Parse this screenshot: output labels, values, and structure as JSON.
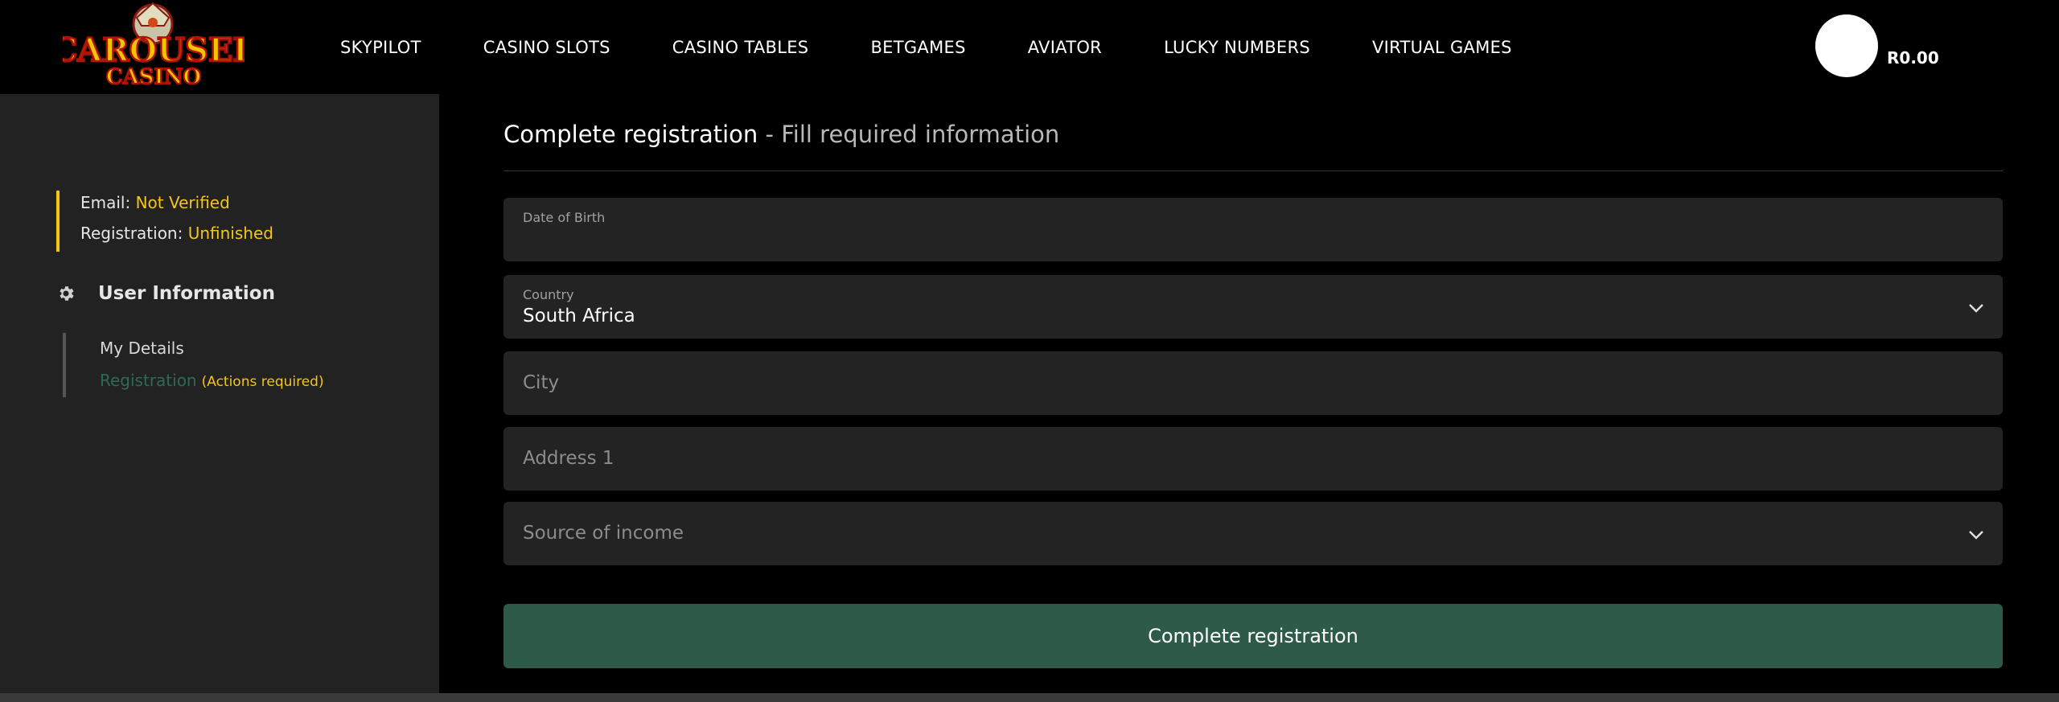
{
  "header": {
    "logo": {
      "line1": "CAROUSEL",
      "line2": "CASINO"
    },
    "nav": [
      "SKYPILOT",
      "CASINO SLOTS",
      "CASINO TABLES",
      "BETGAMES",
      "AVIATOR",
      "LUCKY NUMBERS",
      "VIRTUAL GAMES"
    ],
    "balance": "R0.00"
  },
  "sidebar": {
    "email_label": "Email: ",
    "email_status": "Not Verified",
    "registration_label": "Registration: ",
    "registration_status": "Unfinished",
    "section_title": "User Information",
    "items": {
      "details": "My Details",
      "registration": "Registration",
      "registration_note": "(Actions required)"
    }
  },
  "main": {
    "title": "Complete registration",
    "subtitle": " - Fill required information",
    "fields": {
      "dob": {
        "label": "Date of Birth",
        "value": ""
      },
      "country": {
        "label": "Country",
        "value": "South Africa"
      },
      "city": {
        "placeholder": "City"
      },
      "address1": {
        "placeholder": "Address 1"
      },
      "income": {
        "placeholder": "Source of income"
      }
    },
    "submit_label": "Complete registration"
  },
  "colors": {
    "accent_yellow": "#f5c518",
    "accent_green": "#2e5a48",
    "sidebar_bg": "#222222",
    "field_bg": "#232323"
  },
  "icons": {
    "settings": "gear-icon",
    "dropdown": "chevron-down-icon"
  }
}
